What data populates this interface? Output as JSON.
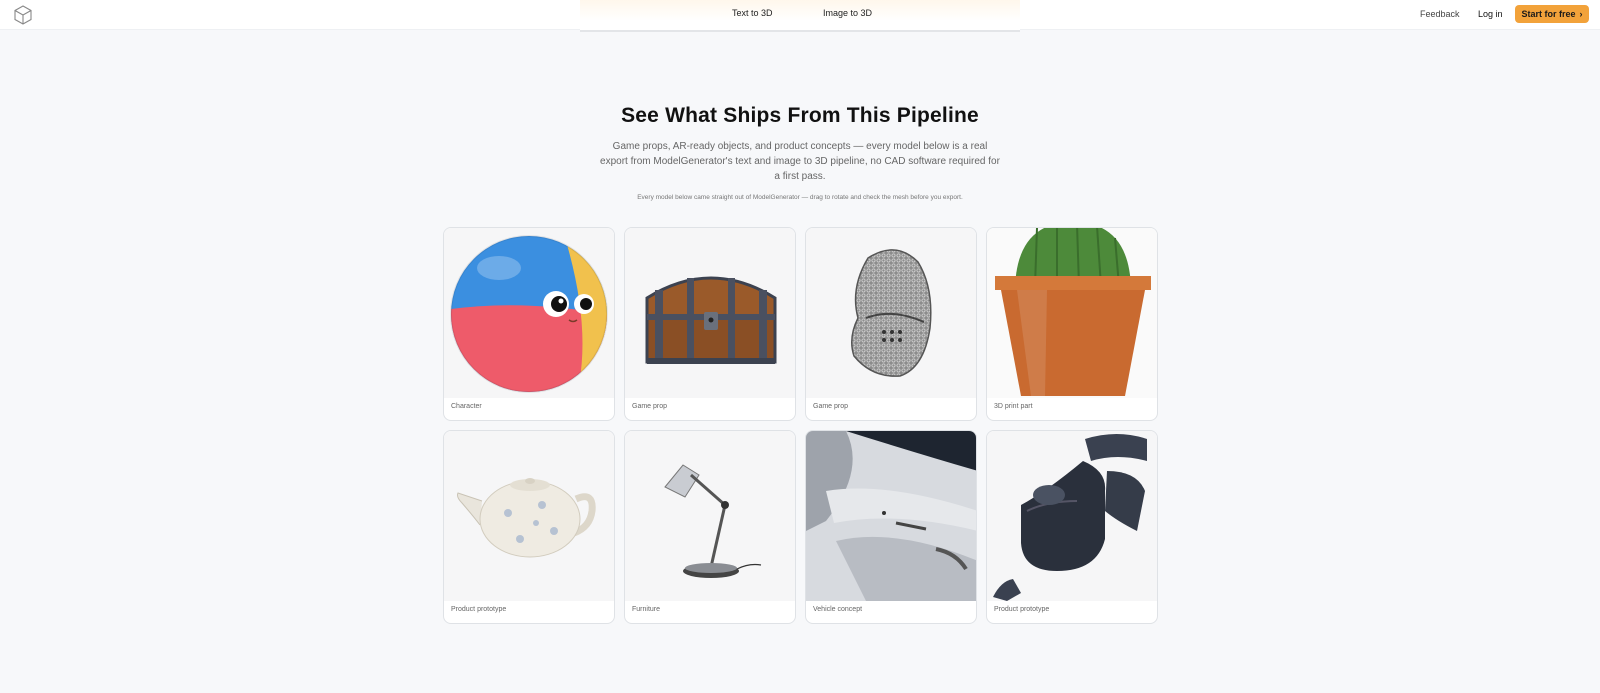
{
  "nav": {
    "tabs": [
      "Text to 3D",
      "Image to 3D"
    ],
    "feedback": "Feedback",
    "login": "Log in",
    "cta": "Start for free",
    "cta_icon": "chevron-right-icon",
    "logo_icon": "cube-icon"
  },
  "hero": {
    "title": "See What Ships From This Pipeline",
    "subtitle": "Game props, AR-ready objects, and product concepts — every model below is a real export from ModelGenerator's text and image to 3D pipeline, no CAD software required for a first pass.",
    "caption": "Every model below came straight out of ModelGenerator — drag to rotate and check the mesh before you export."
  },
  "gallery": [
    {
      "label": "Character",
      "icon": "ball-character-icon"
    },
    {
      "label": "Game prop",
      "icon": "treasure-chest-icon"
    },
    {
      "label": "Game prop",
      "icon": "knight-helmet-icon"
    },
    {
      "label": "3D print part",
      "icon": "cactus-pot-icon"
    },
    {
      "label": "Product prototype",
      "icon": "teapot-icon"
    },
    {
      "label": "Furniture",
      "icon": "desk-lamp-icon"
    },
    {
      "label": "Vehicle concept",
      "icon": "vehicle-panel-icon"
    },
    {
      "label": "Product prototype",
      "icon": "device-icon"
    }
  ],
  "colors": {
    "accent": "#f2a23a",
    "background": "#f7f8fa",
    "card_border": "#dfe2e6"
  }
}
